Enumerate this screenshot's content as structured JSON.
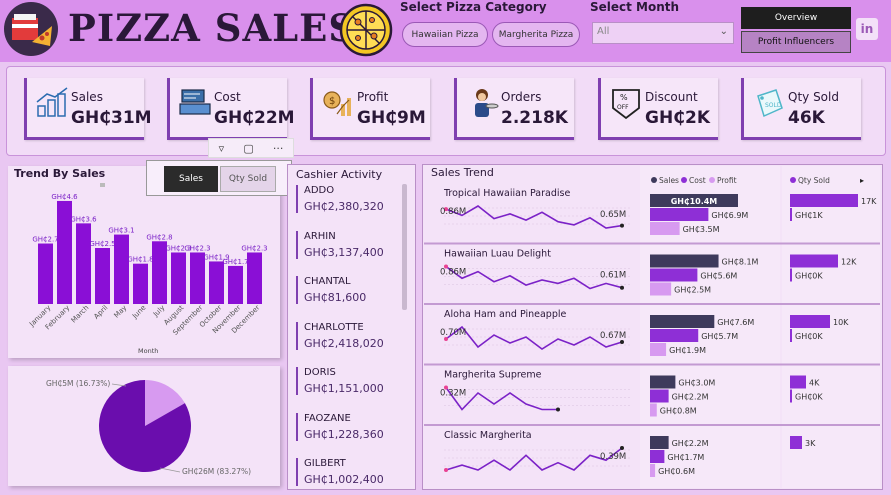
{
  "header": {
    "title": "PIZZA SALES",
    "category_label": "Select Pizza Category",
    "categories": [
      "Hawaiian Pizza",
      "Margherita Pizza"
    ],
    "month_label": "Select Month",
    "month_value": "All",
    "nav": {
      "overview": "Overview",
      "profit": "Profit Influencers"
    },
    "linkedin": "in"
  },
  "kpis": [
    {
      "label": "Sales",
      "value": "GH₵31M"
    },
    {
      "label": "Cost",
      "value": "GH₵22M"
    },
    {
      "label": "Profit",
      "value": "GH₵9M"
    },
    {
      "label": "Orders",
      "value": "2.218K"
    },
    {
      "label": "Discount",
      "value": "GH₵2K"
    },
    {
      "label": "Qty Sold",
      "value": "46K"
    }
  ],
  "trend_by_sales": {
    "title": "Trend By Sales",
    "toggle": {
      "sales": "Sales",
      "qty": "Qty Sold"
    },
    "xlabel": "Month",
    "months": [
      "January",
      "February",
      "March",
      "April",
      "May",
      "June",
      "July",
      "August",
      "September",
      "October",
      "November",
      "December"
    ],
    "values": [
      2.7,
      4.6,
      3.6,
      2.5,
      3.1,
      1.8,
      2.8,
      2.3,
      2.3,
      1.9,
      1.7,
      2.3
    ],
    "data_labels": [
      "GH₵2.7",
      "GH₵4.6",
      "GH₵3.6",
      "GH₵2.5",
      "GH₵3.1",
      "GH₵1.8",
      "GH₵2.8",
      "GH₵2.3",
      "GH₵2.3",
      "GH₵1.9",
      "GH₵1.7",
      "GH₵2.3"
    ]
  },
  "pie": {
    "slices": [
      {
        "label": "GH₵5M (16.73%)",
        "value": 16.73,
        "color": "#d79af0"
      },
      {
        "label": "GH₵26M (83.27%)",
        "value": 83.27,
        "color": "#6a0dad"
      }
    ]
  },
  "cashier": {
    "title": "Cashier Activity",
    "items": [
      {
        "name": "ADDO",
        "value": "GH₵2,380,320"
      },
      {
        "name": "ARHIN",
        "value": "GH₵3,137,400"
      },
      {
        "name": "CHANTAL",
        "value": "GH₵81,600"
      },
      {
        "name": "CHARLOTTE",
        "value": "GH₵2,418,020"
      },
      {
        "name": "DORIS",
        "value": "GH₵1,151,000"
      },
      {
        "name": "FAOZANE",
        "value": "GH₵1,228,360"
      },
      {
        "name": "GILBERT",
        "value": "GH₵1,002,400"
      }
    ]
  },
  "sales_trend": {
    "title": "Sales Trend",
    "legend": [
      "Sales",
      "Cost",
      "Profit"
    ],
    "qty_legend": "Qty Sold",
    "colors": {
      "sales": "#3e3a5c",
      "cost": "#8e2fd6",
      "profit": "#d79af0",
      "line": "#7b22c7"
    },
    "rows": [
      {
        "name": "Tropical Hawaiian Paradise",
        "start": "0.86M",
        "end": "0.65M",
        "spark": [
          0.86,
          0.78,
          0.9,
          0.74,
          0.8,
          0.72,
          0.82,
          0.7,
          0.66,
          0.75,
          0.62,
          0.65
        ],
        "sales": 10.4,
        "sales_l": "GH₵10.4M",
        "cost": 6.9,
        "cost_l": "GH₵6.9M",
        "profit": 3.5,
        "profit_l": "GH₵3.5M",
        "qty": 17,
        "qty_l": "17K",
        "qty_sub": "GH₵1K"
      },
      {
        "name": "Hawaiian Luau Delight",
        "start": "0.86M",
        "end": "0.61M",
        "spark": [
          0.86,
          0.72,
          0.8,
          0.68,
          0.75,
          0.64,
          0.7,
          0.66,
          0.72,
          0.6,
          0.66,
          0.61
        ],
        "sales": 8.1,
        "sales_l": "GH₵8.1M",
        "cost": 5.6,
        "cost_l": "GH₵5.6M",
        "profit": 2.5,
        "profit_l": "GH₵2.5M",
        "qty": 12,
        "qty_l": "12K",
        "qty_sub": "GH₵0K"
      },
      {
        "name": "Aloha Ham and Pineapple",
        "start": "0.70M",
        "end": "0.67M",
        "spark": [
          0.7,
          0.82,
          0.62,
          0.74,
          0.66,
          0.72,
          0.6,
          0.7,
          0.64,
          0.72,
          0.62,
          0.67
        ],
        "sales": 7.6,
        "sales_l": "GH₵7.6M",
        "cost": 5.7,
        "cost_l": "GH₵5.7M",
        "profit": 1.9,
        "profit_l": "GH₵1.9M",
        "qty": 10,
        "qty_l": "10K",
        "qty_sub": "GH₵0K"
      },
      {
        "name": "Margherita Supreme",
        "start": "0.32M",
        "end": "",
        "spark": [
          0.32,
          0.24,
          0.3,
          0.26,
          0.3,
          0.26,
          0.24,
          0.24,
          null,
          null,
          null,
          null
        ],
        "sales": 3.0,
        "sales_l": "GH₵3.0M",
        "cost": 2.2,
        "cost_l": "GH₵2.2M",
        "profit": 0.8,
        "profit_l": "GH₵0.8M",
        "qty": 4,
        "qty_l": "4K",
        "qty_sub": "GH₵0K"
      },
      {
        "name": "Classic Margherita",
        "start": "",
        "end": "0.39M",
        "spark": [
          0.3,
          0.32,
          0.3,
          0.34,
          0.3,
          0.36,
          0.3,
          0.33,
          0.3,
          0.36,
          0.34,
          0.39
        ],
        "sales": 2.2,
        "sales_l": "GH₵2.2M",
        "cost": 1.7,
        "cost_l": "GH₵1.7M",
        "profit": 0.6,
        "profit_l": "GH₵0.6M",
        "qty": 3,
        "qty_l": "3K",
        "qty_sub": ""
      }
    ]
  }
}
